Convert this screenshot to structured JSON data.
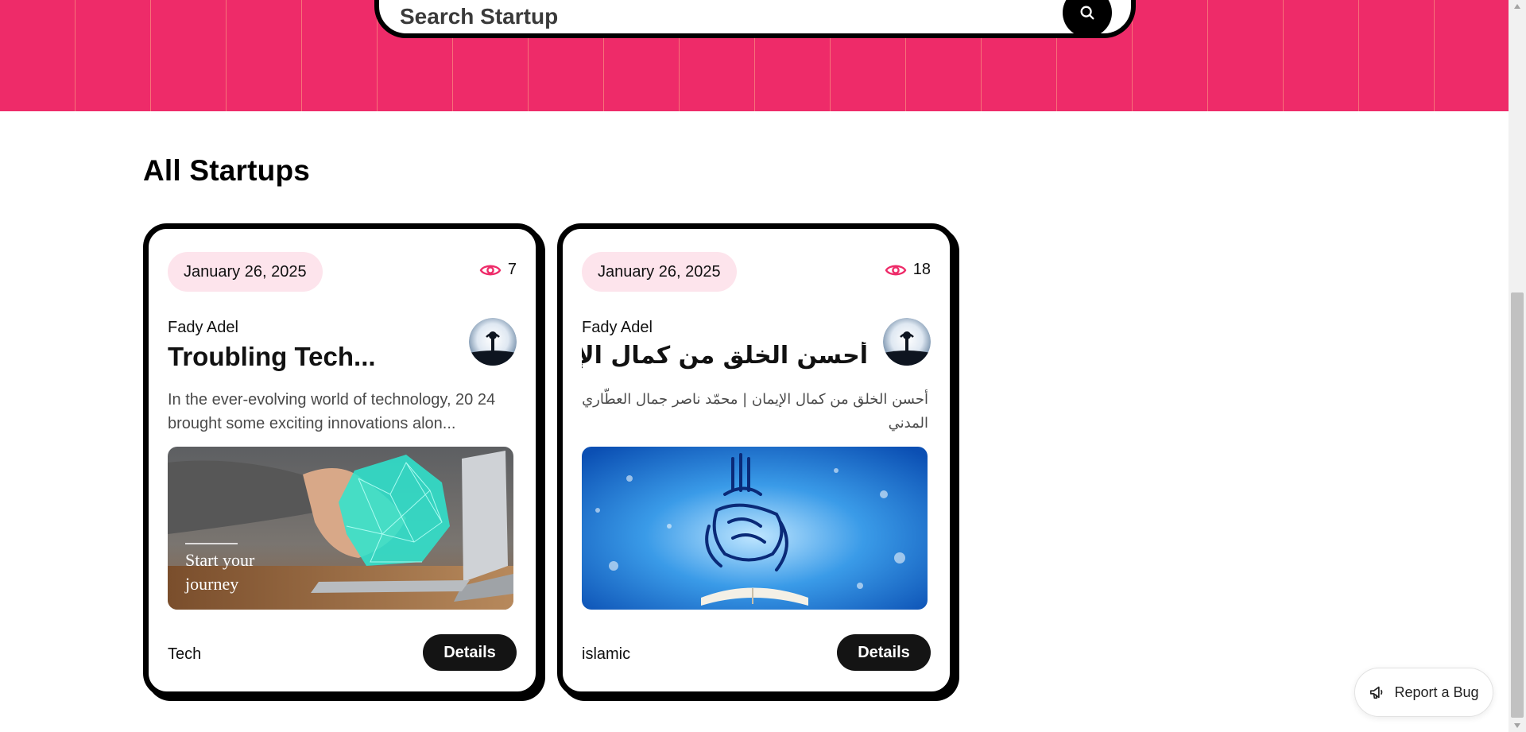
{
  "search": {
    "placeholder": "Search Startup",
    "button_icon": "search-icon"
  },
  "section": {
    "title": "All Startups"
  },
  "colors": {
    "hero": "#ee2b69",
    "pill": "#fde4ec",
    "accent": "#ee2b69",
    "button": "#141414"
  },
  "startups": [
    {
      "date": "January 26, 2025",
      "views": "7",
      "author": "Fady Adel",
      "title": "Troubling Tech...",
      "description": "In the ever-evolving world of technology, 20 24 brought some exciting innovations alon...",
      "image_caption_line1": "Start your",
      "image_caption_line2": "journey",
      "category": "Tech",
      "details_label": "Details"
    },
    {
      "date": "January 26, 2025",
      "views": "18",
      "author": "Fady Adel",
      "title": "أحسن الخلق من كمال الإيمان",
      "description": "أحسن الخلق من كمال الإيمان | محمّد ناصر جمال العطّاري المدني",
      "category": "islamic",
      "details_label": "Details"
    }
  ],
  "report_bug": {
    "label": "Report a Bug",
    "icon": "megaphone-icon"
  }
}
